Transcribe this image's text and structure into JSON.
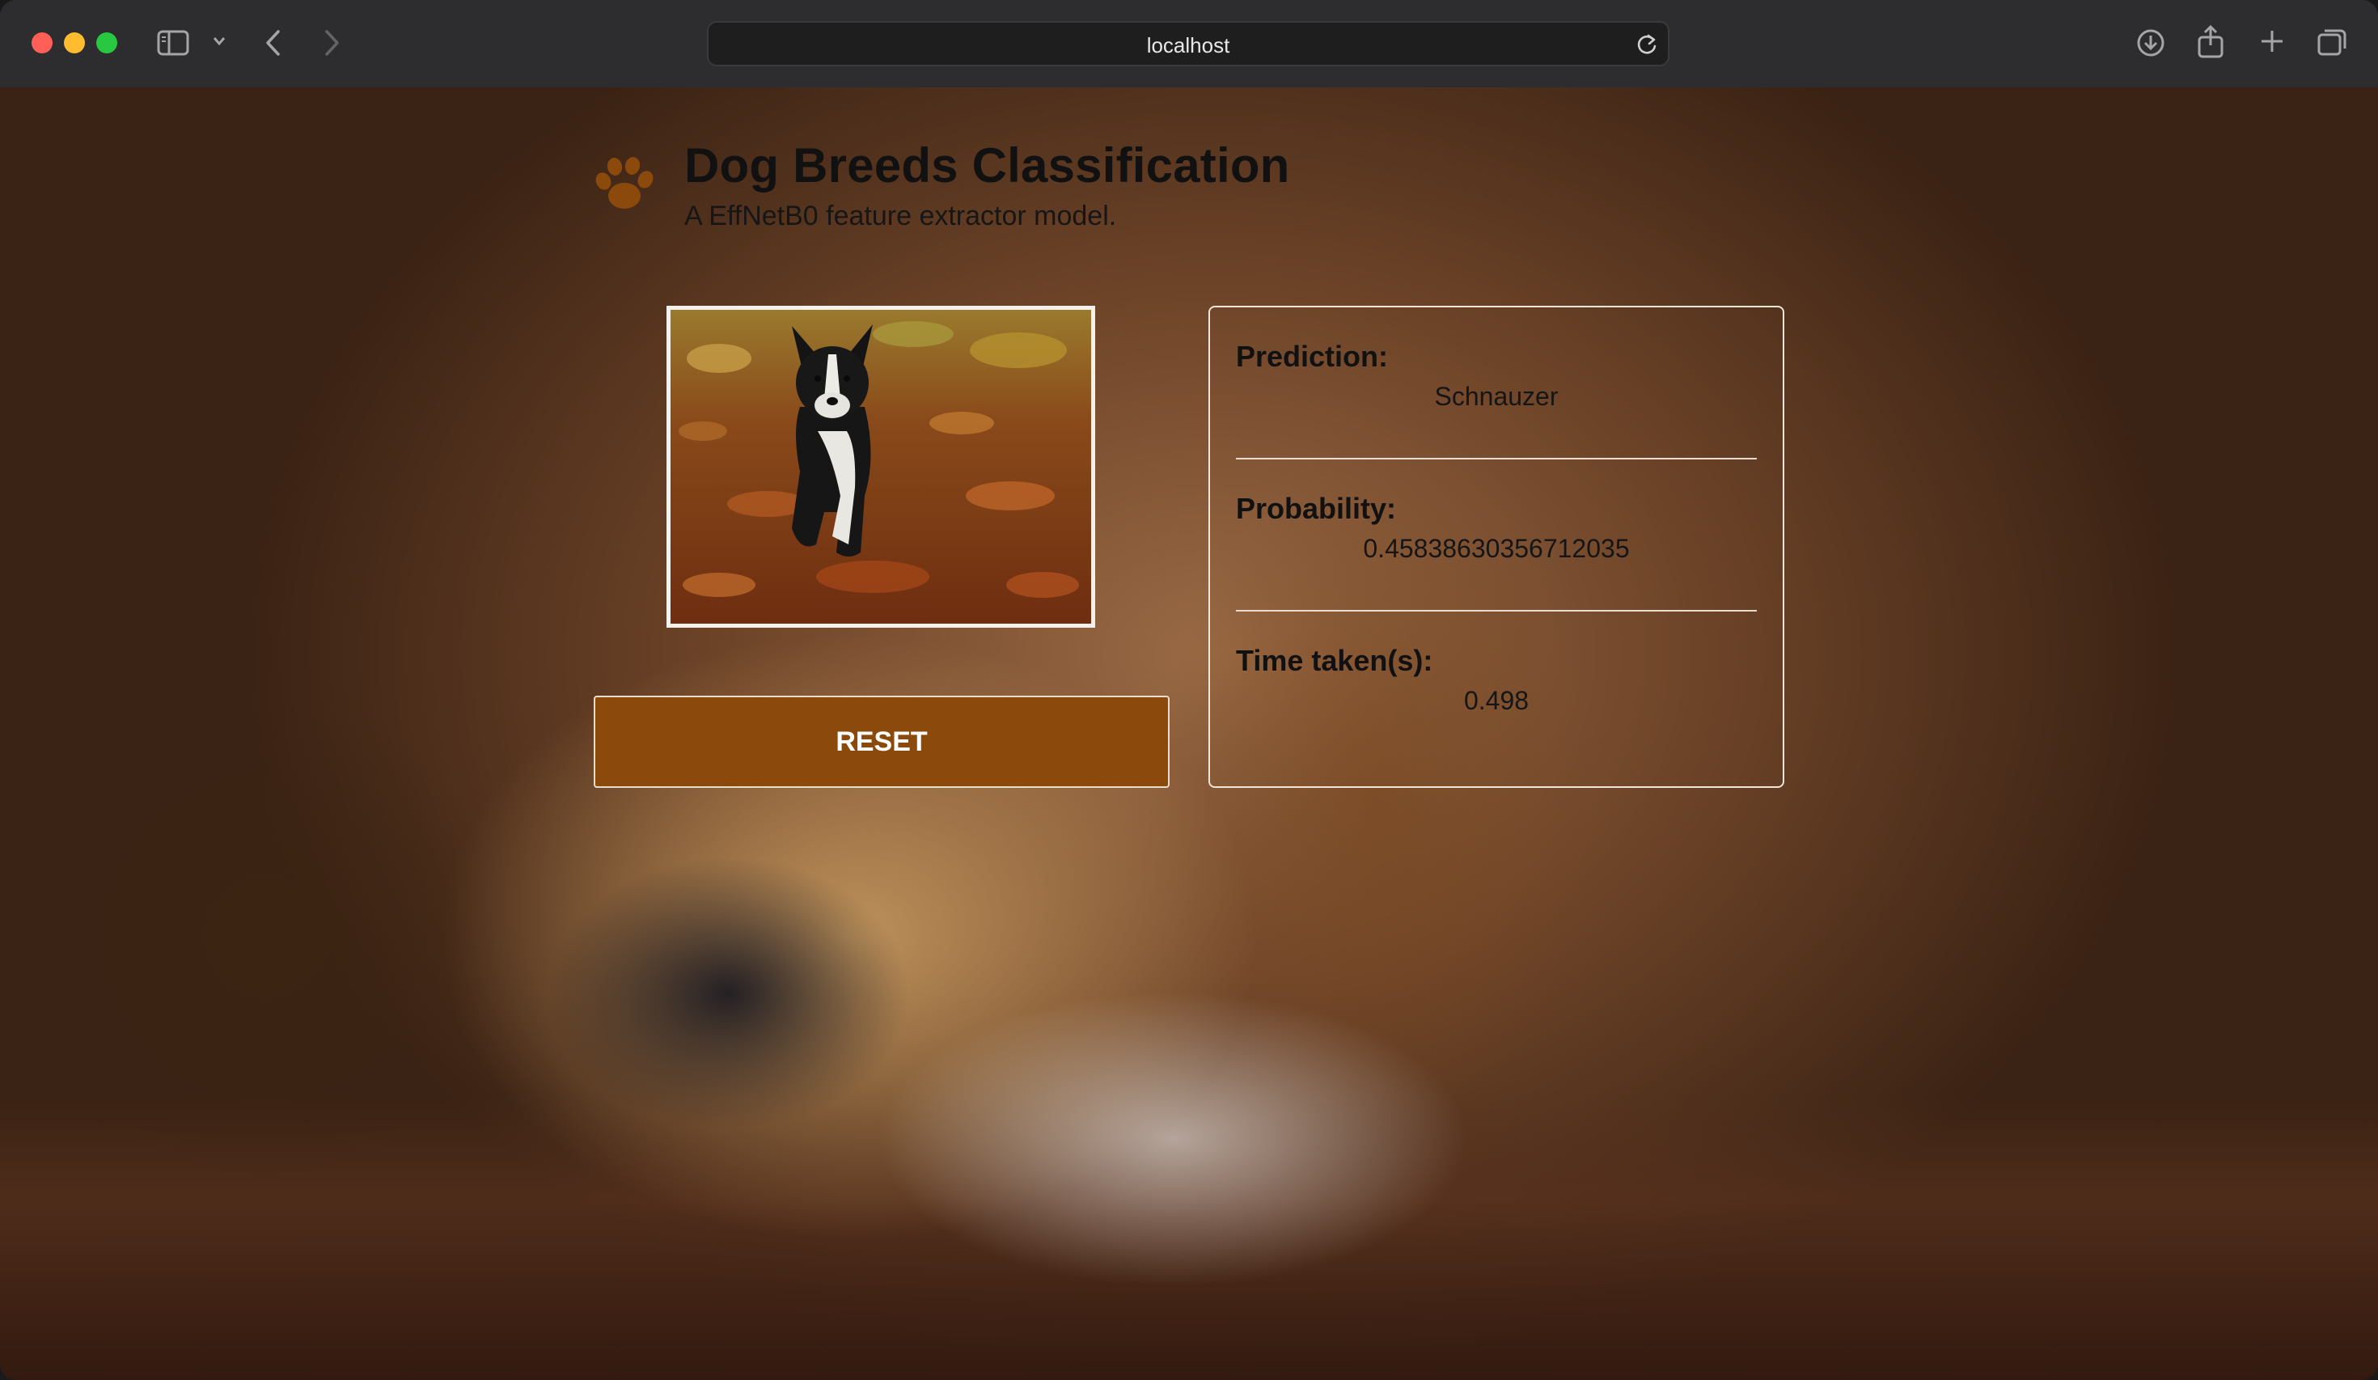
{
  "browser": {
    "address": "localhost"
  },
  "header": {
    "title": "Dog Breeds Classification",
    "subtitle": "A EffNetB0 feature extractor model."
  },
  "reset_label": "RESET",
  "results": {
    "prediction_label": "Prediction:",
    "prediction_value": "Schnauzer",
    "probability_label": "Probability:",
    "probability_value": "0.45838630356712035",
    "time_label": "Time taken(s):",
    "time_value": "0.498"
  },
  "colors": {
    "accent": "#8b4a0b",
    "paw": "#8b4a0b"
  }
}
